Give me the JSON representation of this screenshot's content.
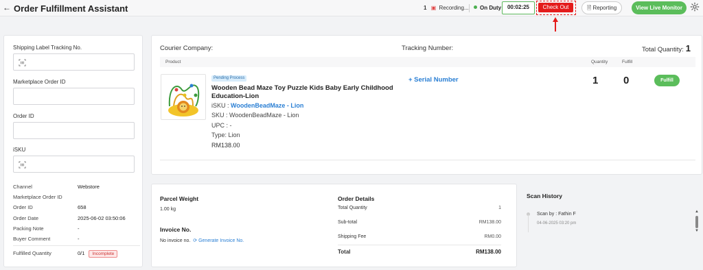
{
  "header": {
    "back_icon": "back-arrow-icon",
    "title": "Order Fulfillment Assistant",
    "recording_count": "1",
    "recording_label": "Recording...",
    "duty_label": "On Duty",
    "timer": "00:02:25",
    "checkout_label": "Check Out",
    "reporting_label": "Reporting",
    "live_monitor_label": "View Live Monitor",
    "accent_red": "#e41b1b",
    "accent_green": "#5bbd5b"
  },
  "left_panel": {
    "fields": [
      {
        "label": "Shipping Label Tracking No.",
        "value": "",
        "icon": "barcode-scan-icon"
      },
      {
        "label": "Marketplace Order ID",
        "value": ""
      },
      {
        "label": "Order ID",
        "value": ""
      },
      {
        "label": "iSKU",
        "value": "",
        "icon": "barcode-scan-icon"
      }
    ],
    "info": [
      {
        "key": "Channel",
        "value": "Webstore"
      },
      {
        "key": "Marketplace Order ID",
        "value": ""
      },
      {
        "key": "Order ID",
        "value": "658"
      },
      {
        "key": "Order Date",
        "value": "2025-06-02 03:50:06"
      },
      {
        "key": "Packing Note",
        "value": "-"
      },
      {
        "key": "Buyer Comment",
        "value": "-"
      }
    ],
    "fulfilled_label": "Fulfilled Quantity",
    "fulfilled_value": "0/1",
    "fulfilled_status": "Incomplete"
  },
  "main": {
    "courier_label": "Courier Company:",
    "tracking_label": "Tracking Number:",
    "total_qty_label": "Total Quantity:",
    "total_qty_value": "1",
    "columns": {
      "product": "Product",
      "quantity": "Quantity",
      "fulfill": "Fulfill"
    },
    "item": {
      "status": "Pending Process",
      "title": "Wooden Bead Maze Toy Puzzle Kids Baby Early Childhood Education-Lion",
      "isku_label": "iSKU : ",
      "isku_value": "WoodenBeadMaze - Lion",
      "sku": "SKU : WoodenBeadMaze - Lion",
      "upc": "UPC : -",
      "type": "Type: Lion",
      "price": "RM138.00",
      "serial_label": "+ Serial Number",
      "quantity": "1",
      "fulfilled": "0",
      "fulfill_button": "Fulfill"
    }
  },
  "bottom": {
    "parcel_weight_label": "Parcel Weight",
    "parcel_weight_value": "1.00 kg",
    "invoice_label": "Invoice No.",
    "invoice_value": "No invoice no.",
    "generate_invoice_label": "Generate Invoice No.",
    "order_details_label": "Order Details",
    "order_rows": [
      {
        "key": "Total Quantity",
        "value": "1"
      },
      {
        "key": "Sub-total",
        "value": "RM138.00"
      },
      {
        "key": "Shipping Fee",
        "value": "RM0.00"
      }
    ],
    "total_label": "Total",
    "total_value": "RM138.00"
  },
  "scan_history": {
    "title": "Scan History",
    "entries": [
      {
        "by": "Scan by : Fathin F",
        "time": "04-06-2025 03:20 pm"
      }
    ]
  }
}
